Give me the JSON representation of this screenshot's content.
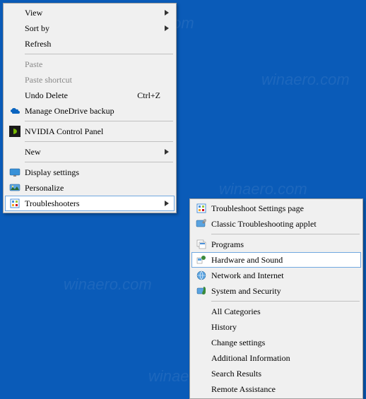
{
  "watermarks": [
    "winaero.com",
    "winaero.com",
    "winaero.com",
    "winaero.com",
    "winaero.com"
  ],
  "main_menu": {
    "view": {
      "label": "View"
    },
    "sort_by": {
      "label": "Sort by"
    },
    "refresh": {
      "label": "Refresh"
    },
    "paste": {
      "label": "Paste"
    },
    "paste_shortcut": {
      "label": "Paste shortcut"
    },
    "undo_delete": {
      "label": "Undo Delete",
      "shortcut": "Ctrl+Z"
    },
    "manage_onedrive": {
      "label": "Manage OneDrive backup"
    },
    "nvidia": {
      "label": "NVIDIA Control Panel"
    },
    "new": {
      "label": "New"
    },
    "display_settings": {
      "label": "Display settings"
    },
    "personalize": {
      "label": "Personalize"
    },
    "troubleshooters": {
      "label": "Troubleshooters"
    }
  },
  "sub_menu": {
    "troubleshoot_settings": {
      "label": "Troubleshoot Settings page"
    },
    "classic_applet": {
      "label": "Classic Troubleshooting applet"
    },
    "programs": {
      "label": "Programs"
    },
    "hardware_sound": {
      "label": "Hardware and Sound"
    },
    "network_internet": {
      "label": "Network and Internet"
    },
    "system_security": {
      "label": "System and Security"
    },
    "all_categories": {
      "label": "All Categories"
    },
    "history": {
      "label": "History"
    },
    "change_settings": {
      "label": "Change settings"
    },
    "additional_info": {
      "label": "Additional Information"
    },
    "search_results": {
      "label": "Search Results"
    },
    "remote_assistance": {
      "label": "Remote Assistance"
    }
  }
}
